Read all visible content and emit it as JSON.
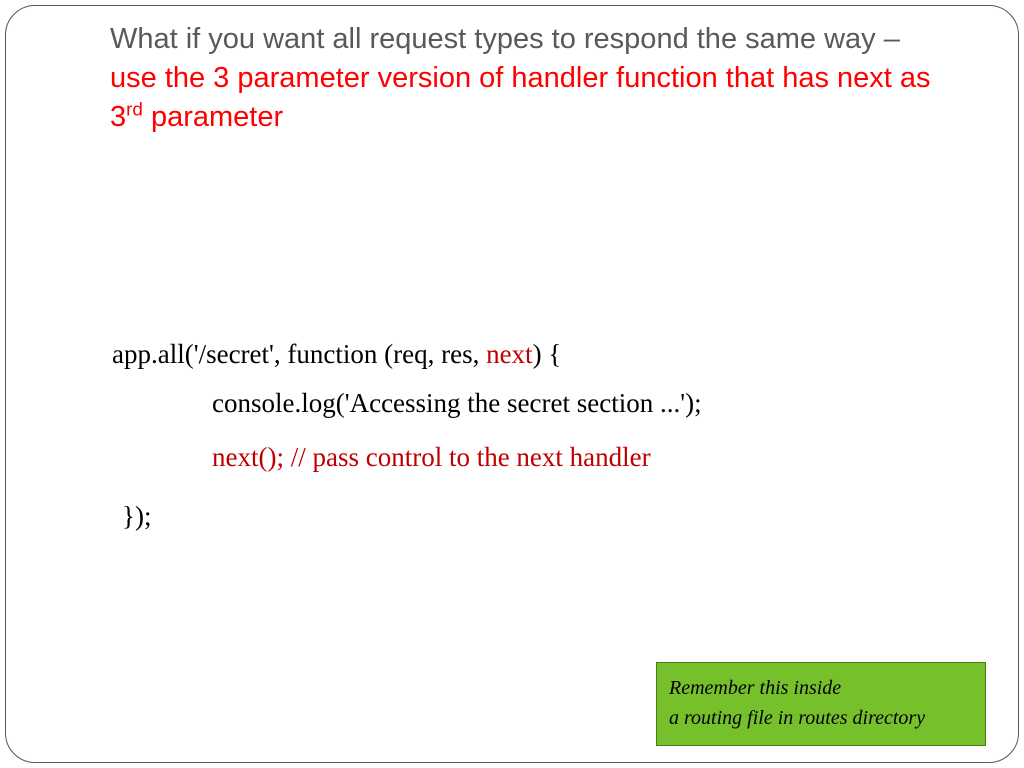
{
  "heading": {
    "grey": "What if you want all request types to respond the same way –",
    "red_part1": "use the 3 parameter version of handler function that has next as 3",
    "red_sup": "rd",
    "red_part2": " parameter"
  },
  "code": {
    "line1_a": "app.all('/secret', function (req, res, ",
    "line1_next": "next",
    "line1_b": ") {",
    "line2": "console.log('Accessing the secret section ...');",
    "line3": "next(); // pass control to the next handler",
    "line4": "});"
  },
  "note": {
    "line1": "Remember this inside",
    "line2": "a routing file in routes directory"
  }
}
